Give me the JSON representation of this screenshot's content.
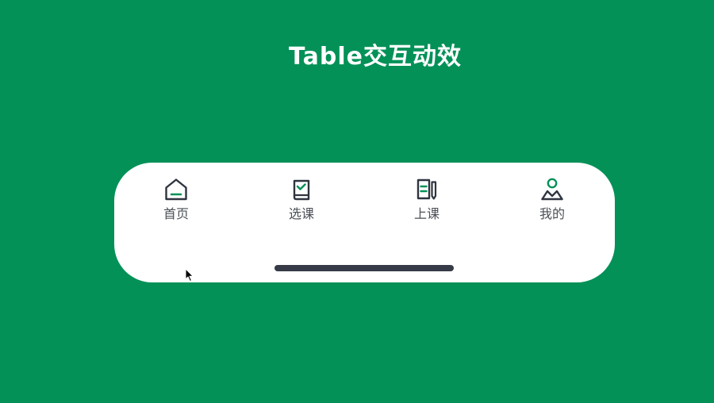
{
  "page": {
    "title": "Table交互动效"
  },
  "tabbar": {
    "tabs": [
      {
        "label": "首页",
        "icon": "home-icon"
      },
      {
        "label": "选课",
        "icon": "book-check-icon"
      },
      {
        "label": "上课",
        "icon": "notebook-pen-icon"
      },
      {
        "label": "我的",
        "icon": "user-profile-icon"
      }
    ]
  },
  "colors": {
    "background": "#039157",
    "accent": "#039157",
    "icon_stroke": "#2f3440",
    "label": "#4b4f55",
    "home_indicator": "#363b47",
    "tabbar_bg": "#ffffff"
  }
}
